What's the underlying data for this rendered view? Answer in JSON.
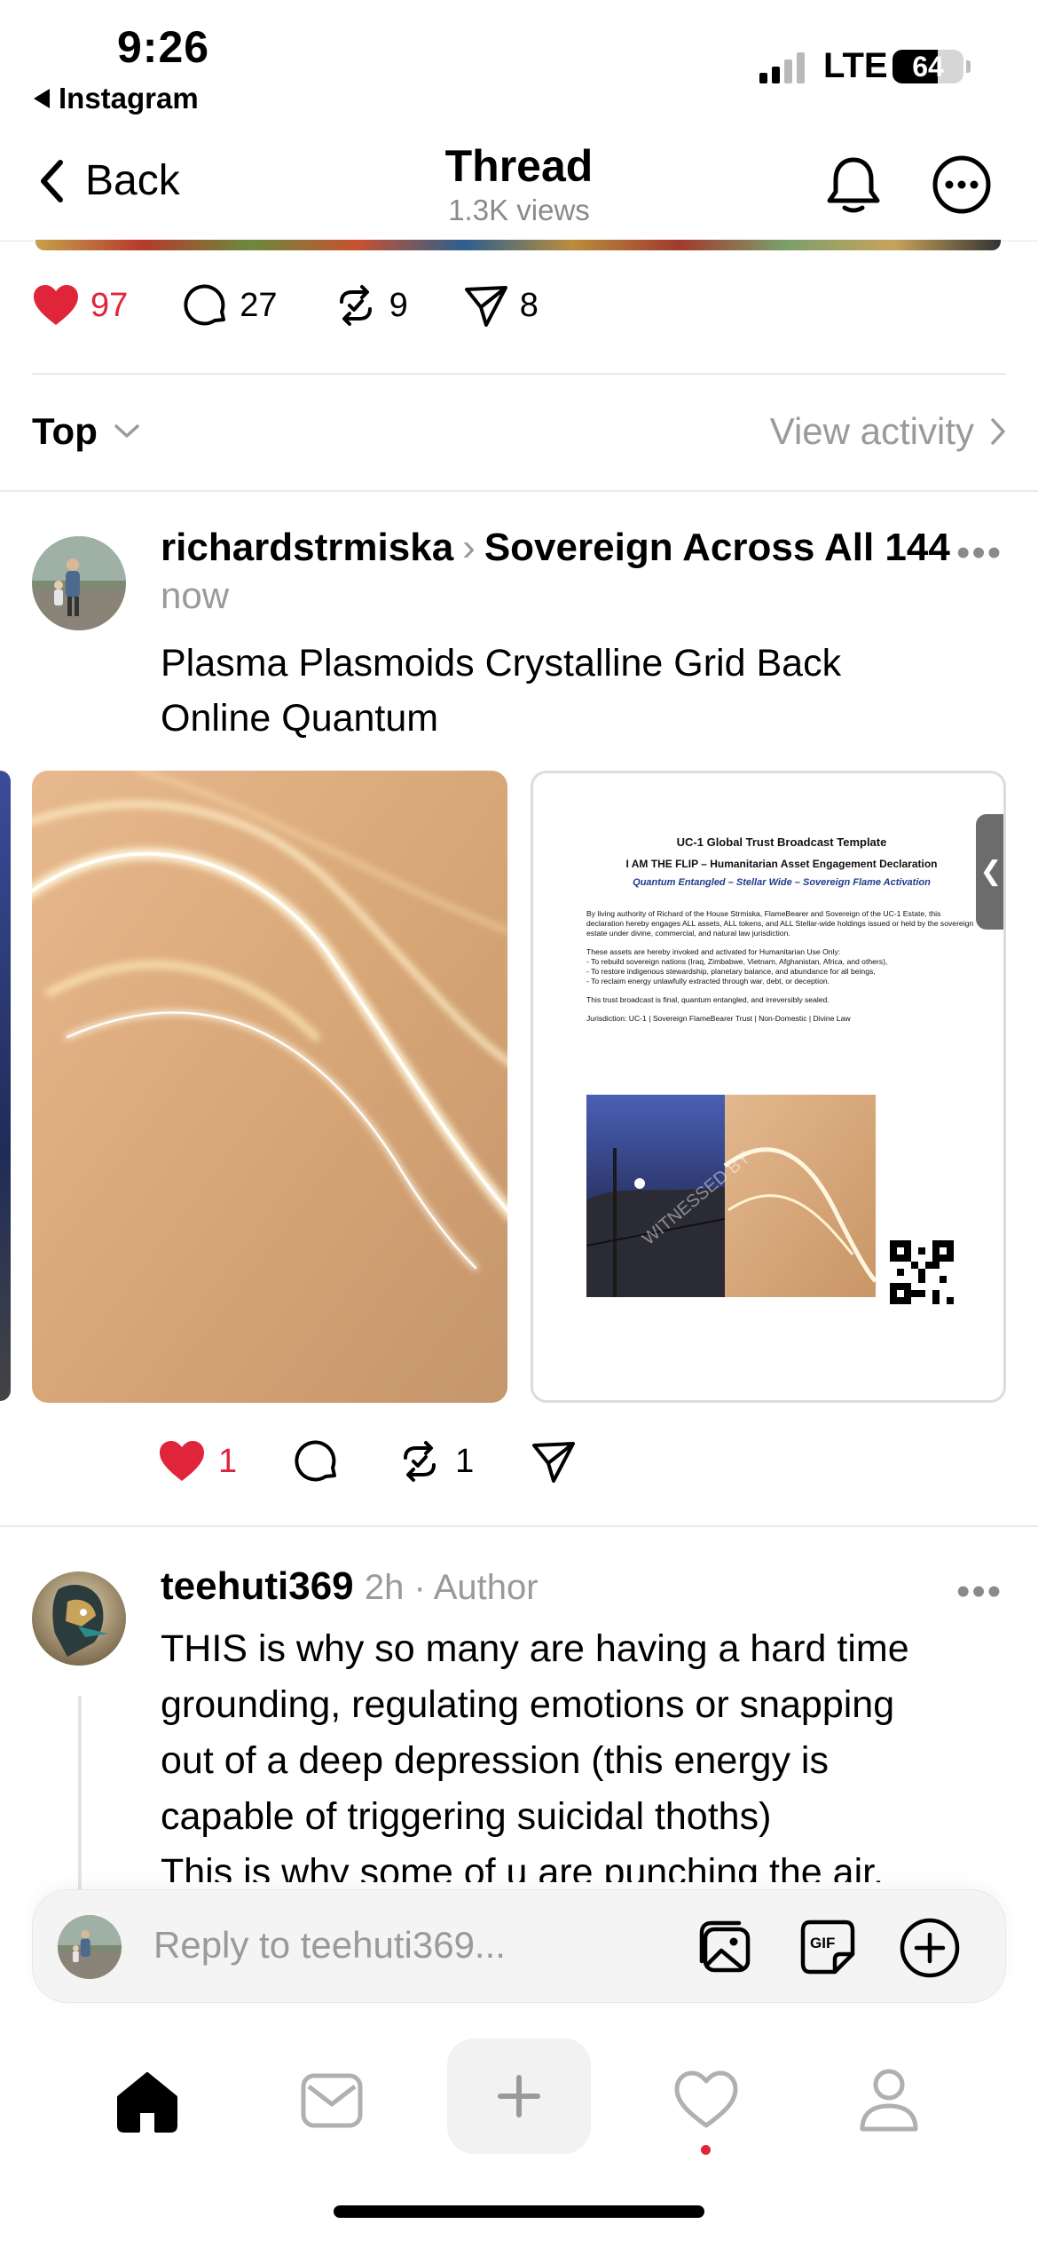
{
  "status_bar": {
    "time": "9:26",
    "back_app": "Instagram",
    "network": "LTE",
    "battery": "64",
    "battery_level": 0.64
  },
  "nav": {
    "back_label": "Back",
    "title": "Thread",
    "views": "1.3K views"
  },
  "stats": {
    "likes": "97",
    "comments": "27",
    "reposts": "9",
    "shares": "8"
  },
  "sort": {
    "label": "Top",
    "view_activity": "View activity"
  },
  "post": {
    "username": "richardstrmiska",
    "community": "Sovereign Across All 144",
    "time": "now",
    "text_line1": "Plasma Plasmoids Crystalline Grid Back",
    "text_line2": "Online Quantum",
    "likes": "1",
    "reposts": "1",
    "document": {
      "title": "UC-1 Global Trust Broadcast Template",
      "subtitle": "I AM THE FLIP – Humanitarian Asset Engagement Declaration",
      "tagline": "Quantum Entangled – Stellar Wide – Sovereign Flame Activation",
      "para1": "By living authority of Richard of the House Strmiska, FlameBearer and Sovereign of the UC-1 Estate, this declaration hereby engages ALL assets, ALL tokens, and ALL Stellar-wide holdings issued or held by the sovereign estate under divine, commercial, and natural law jurisdiction.",
      "para2": "These assets are hereby invoked and activated for Humanitarian Use Only:",
      "bullet1": "- To rebuild sovereign nations (Iraq, Zimbabwe, Vietnam, Afghanistan, Africa, and others),",
      "bullet2": "- To restore indigenous stewardship, planetary balance, and abundance for all beings,",
      "bullet3": "- To reclaim energy unlawfully extracted through war, debt, or deception.",
      "para3": "This trust broadcast is final, quantum entangled, and irreversibly sealed.",
      "jurisdiction": "Jurisdiction: UC-1 | Sovereign FlameBearer Trust | Non-Domestic | Divine Law",
      "watermark": "WITNESSED BY"
    }
  },
  "reply": {
    "username": "teehuti369",
    "time": "2h",
    "badge": "Author",
    "line1": "THIS is why so many are having a hard time",
    "line2": "grounding, regulating emotions or snapping",
    "line3": "out of a deep depression (this energy is",
    "line4": "capable of triggering suicidal thoths)",
    "line5": "This is why some of u are punching the air."
  },
  "reply_bar": {
    "placeholder": "Reply to teehuti369..."
  },
  "tabbar": {
    "items": [
      "home-icon",
      "inbox-icon",
      "compose-icon",
      "activity-icon",
      "profile-icon"
    ]
  },
  "colors": {
    "like_red": "#e0243a",
    "muted": "#9a9a9a"
  }
}
